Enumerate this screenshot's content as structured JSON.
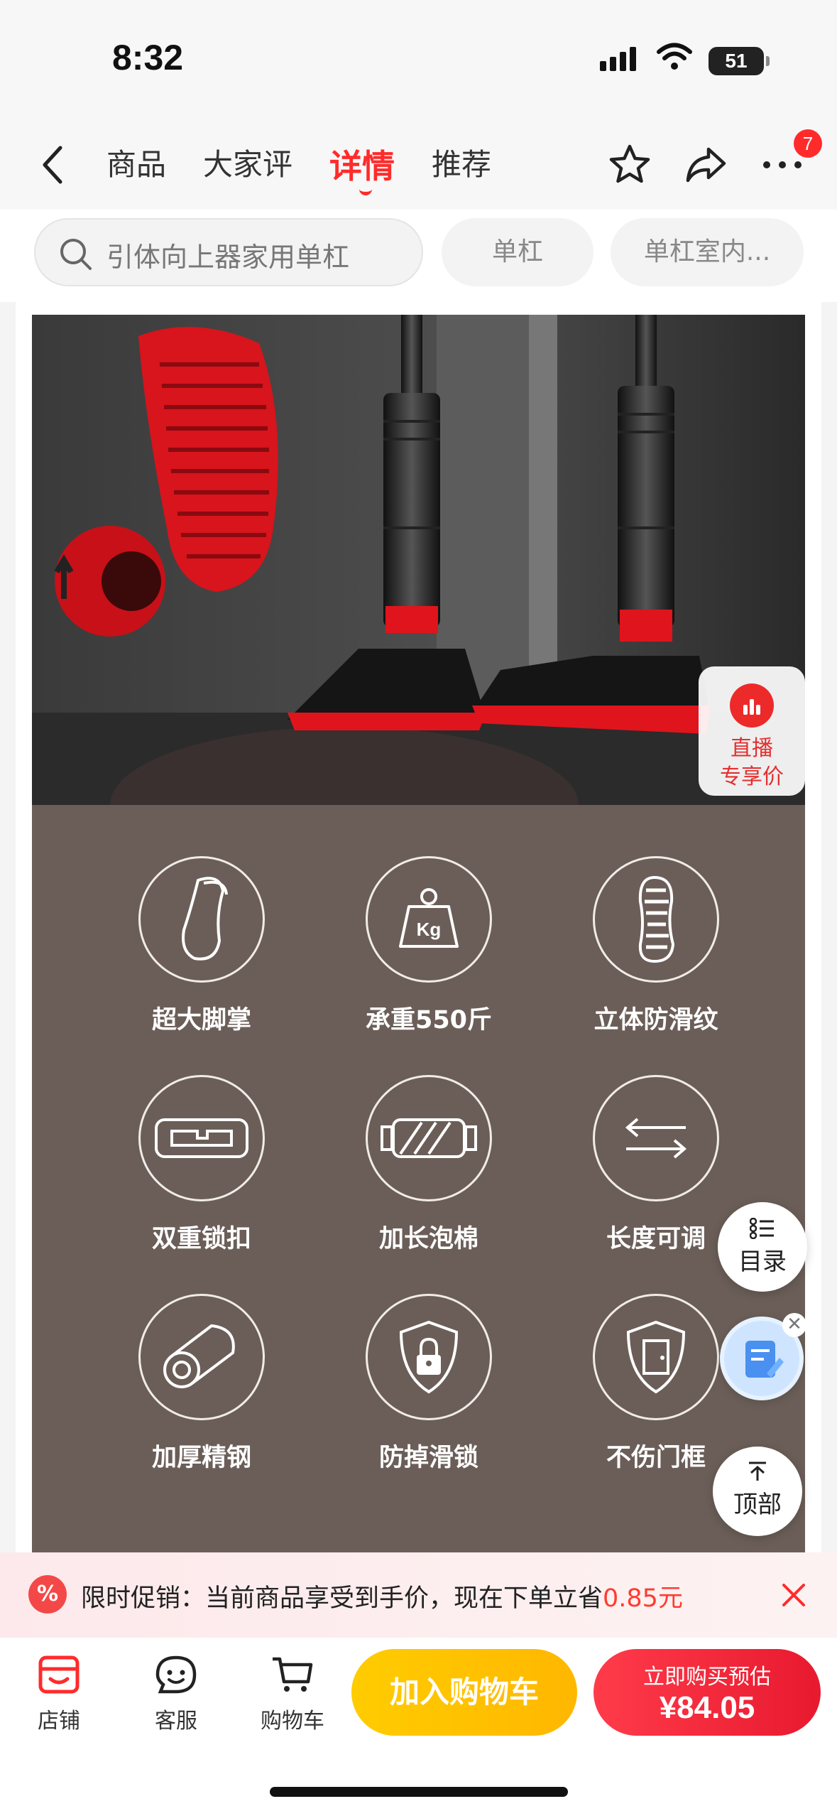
{
  "status_bar": {
    "time": "8:32",
    "battery": "51"
  },
  "nav": {
    "tabs": [
      {
        "label": "商品",
        "active": false
      },
      {
        "label": "大家评",
        "active": false
      },
      {
        "label": "详情",
        "active": true
      },
      {
        "label": "推荐",
        "active": false
      }
    ],
    "icons": [
      "back-icon",
      "star-icon",
      "share-icon",
      "more-icon"
    ],
    "badge_count": "7"
  },
  "search": {
    "placeholder": "引体向上器家用单杠",
    "chips": [
      "单杠",
      "单杠室内..."
    ]
  },
  "live_badge": {
    "line1": "直播",
    "line2": "专享价"
  },
  "features": [
    {
      "label": "超大脚掌",
      "icon": "foot-pad-icon"
    },
    {
      "label": "承重550斤",
      "icon": "weight-kg-icon"
    },
    {
      "label": "立体防滑纹",
      "icon": "anti-slip-icon"
    },
    {
      "label": "双重锁扣",
      "icon": "double-lock-icon"
    },
    {
      "label": "加长泡棉",
      "icon": "foam-grip-icon"
    },
    {
      "label": "长度可调",
      "icon": "adjust-arrows-icon"
    },
    {
      "label": "加厚精钢",
      "icon": "steel-tube-icon"
    },
    {
      "label": "防掉滑锁",
      "icon": "padlock-shield-icon"
    },
    {
      "label": "不伤门框",
      "icon": "door-frame-icon"
    }
  ],
  "side_buttons": {
    "toc": "目录",
    "top": "顶部"
  },
  "promo": {
    "text": "限时促销：当前商品享受到手价，现在下单立省",
    "amount": "0.85元"
  },
  "bottom_bar": {
    "store": "店铺",
    "service": "客服",
    "cart": "购物车",
    "add_to_cart": "加入购物车",
    "buy_now_label": "立即购买预估",
    "price": "¥84.05"
  },
  "colors": {
    "accent_red": "#ff2b2b",
    "cart_yellow": "#ffc200",
    "feature_bg": "#6b5e58"
  }
}
